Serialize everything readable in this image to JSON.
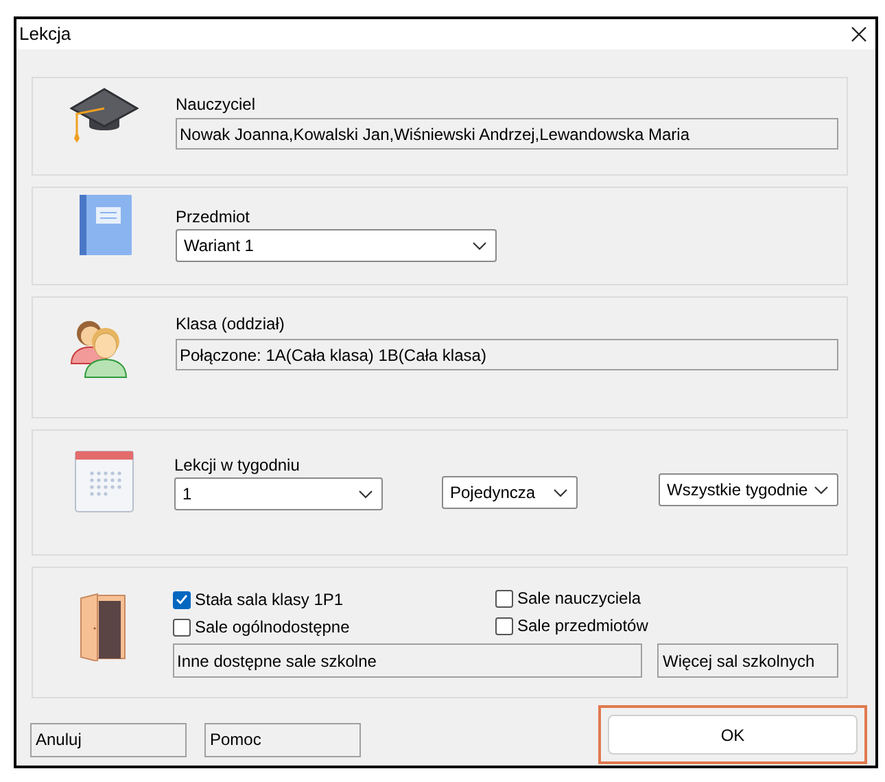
{
  "window": {
    "title": "Lekcja"
  },
  "teacher": {
    "label": "Nauczyciel",
    "value": "Nowak Joanna,Kowalski Jan,Wiśniewski Andrzej,Lewandowska Maria"
  },
  "subject": {
    "label": "Przedmiot",
    "value": "Wariant 1"
  },
  "class": {
    "label": "Klasa (oddział)",
    "value": "Połączone: 1A(Cała klasa) 1B(Cała klasa)"
  },
  "lessons": {
    "label": "Lekcji w tygodniu",
    "count": "1",
    "type": "Pojedyncza",
    "weeks": "Wszystkie tygodnie"
  },
  "rooms": {
    "options": [
      {
        "label": "Stała sala klasy 1P1",
        "checked": true
      },
      {
        "label": "Sale nauczyciela",
        "checked": false
      },
      {
        "label": "Sale ogólnodostępne",
        "checked": false
      },
      {
        "label": "Sale przedmiotów",
        "checked": false
      }
    ],
    "other_rooms": "Inne dostępne sale szkolne",
    "more_button": "Więcej sal szkolnych"
  },
  "buttons": [
    {
      "label": "Anuluj",
      "highlighted": false
    },
    {
      "label": "Pomoc",
      "highlighted": false
    },
    {
      "label": "OK",
      "highlighted": true
    }
  ]
}
